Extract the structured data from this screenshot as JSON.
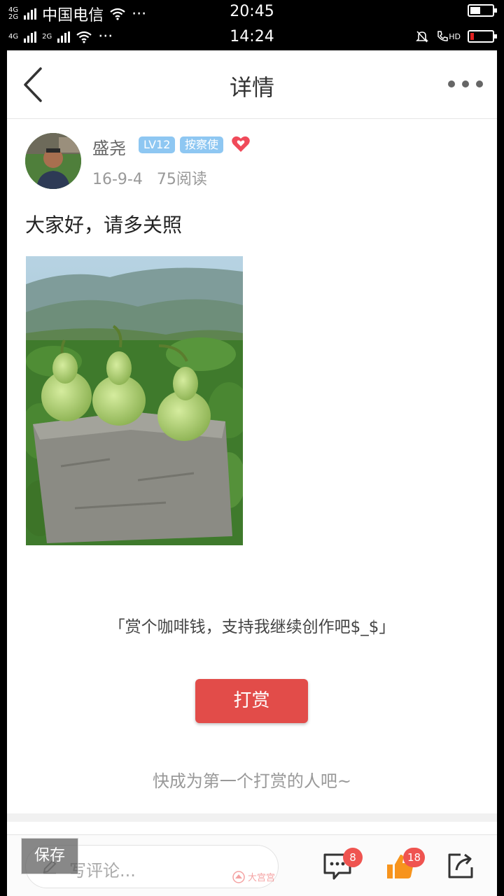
{
  "status_bar_1": {
    "net1": "4G",
    "net2": "2G",
    "carrier": "中国电信",
    "dots": "···",
    "time": "20:45"
  },
  "status_bar_2": {
    "net1": "4G",
    "net2": "2G",
    "dots": "···",
    "time": "14:24",
    "hd": "HD"
  },
  "navbar": {
    "title": "详情"
  },
  "author": {
    "name": "盛尧",
    "level": "LV12",
    "role": "按察使",
    "date": "16-9-4",
    "reads": "75阅读"
  },
  "post": {
    "text": "大家好，请多关照"
  },
  "reward": {
    "prompt": "「赏个咖啡钱，支持我继续创作吧$_$」",
    "button": "打赏",
    "hint": "快成为第一个打赏的人吧~"
  },
  "bottom_bar": {
    "comment_placeholder": "写评论...",
    "comment_count": "8",
    "like_count": "18"
  },
  "overlay": {
    "save_label": "保存"
  },
  "watermark": {
    "text": "大宫宫"
  },
  "colors": {
    "accent_red": "#e24c49",
    "badge_blue": "#8ec7f2",
    "like_orange": "#f7941d"
  }
}
